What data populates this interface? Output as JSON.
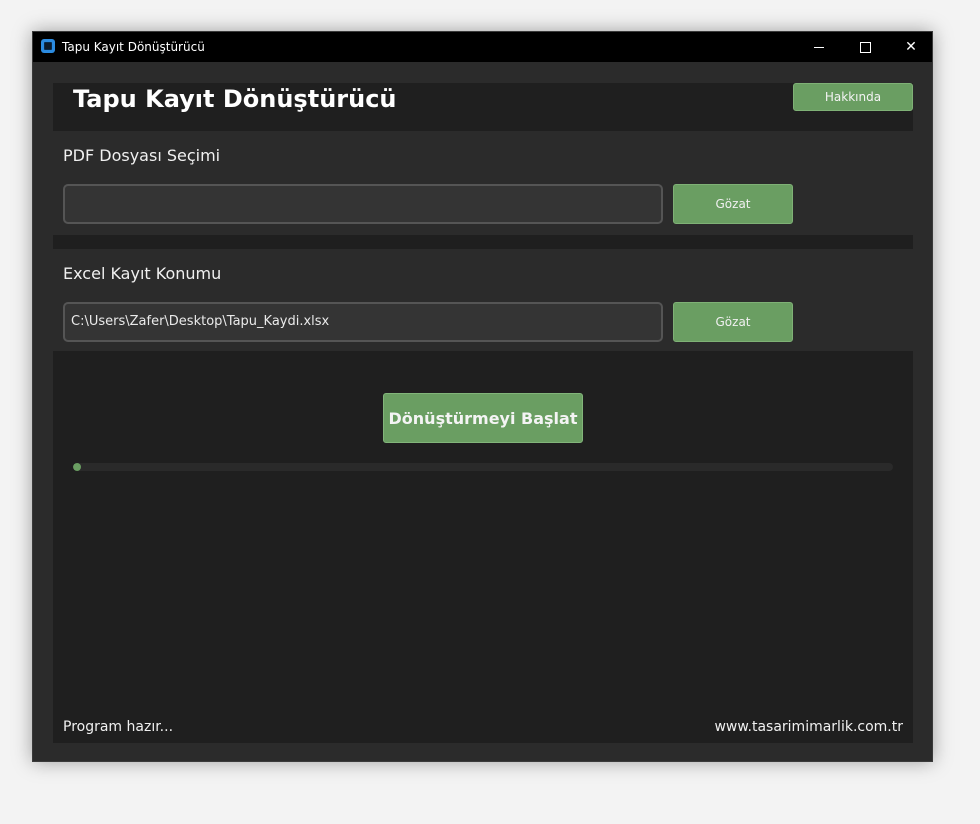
{
  "window": {
    "title": "Tapu Kayıt Dönüştürücü",
    "controls": {
      "minimize_icon": "minimize-icon",
      "maximize_icon": "maximize-icon",
      "close_icon": "close-icon",
      "close_glyph": "✕"
    }
  },
  "header": {
    "title": "Tapu Kayıt Dönüştürücü",
    "about_label": "Hakkında"
  },
  "pdf_section": {
    "label": "PDF Dosyası Seçimi",
    "path_value": "",
    "browse_label": "Gözat"
  },
  "excel_section": {
    "label": "Excel Kayıt Konumu",
    "path_value": "C:\\Users\\Zafer\\Desktop\\Tapu_Kaydi.xlsx",
    "browse_label": "Gözat"
  },
  "main": {
    "start_label": "Dönüştürmeyi Başlat",
    "progress_fraction": 0.01
  },
  "footer": {
    "status": "Program hazır...",
    "website": "www.tasarimimarlik.com.tr"
  },
  "colors": {
    "accent": "#6a9e62",
    "background": "#2b2b2b",
    "panel": "#1f1f1f"
  }
}
